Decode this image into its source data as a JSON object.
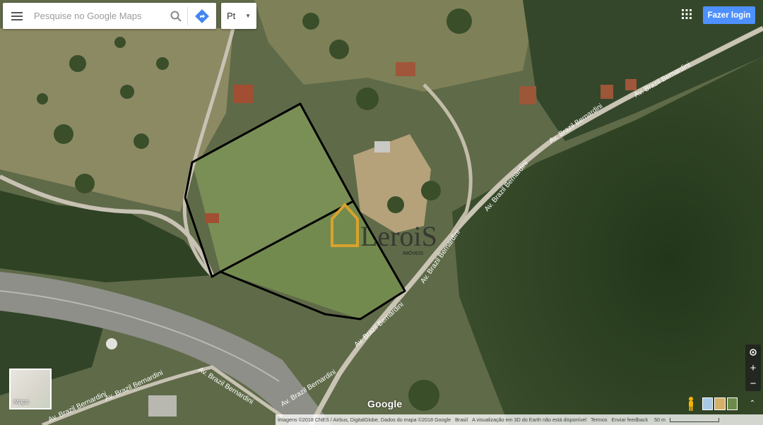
{
  "search": {
    "placeholder": "Pesquise no Google Maps"
  },
  "language": {
    "selected": "Pt"
  },
  "header": {
    "login_label": "Fazer login"
  },
  "thumbnail": {
    "label": "Maps"
  },
  "watermark": {
    "brand": "LeroiS",
    "subtitle": "IMÓVEIS"
  },
  "road_labels": {
    "top_right": "Av. Brazil Bernardini",
    "mid_right": "Av. Brazil Bernardini",
    "center": "Av. Brazil Bernardini",
    "lower_center": "Av. Brazil Bernardini",
    "lower_center_2": "Av. Brazil Bernardini",
    "bottom_left": "Av. Brazil Bernardini",
    "bottom_mid": "Av. Brazil Bernardini",
    "bottom_far_left": "Av. Brazil Bernardini",
    "bottom_left_edge": "Av. Brazil Bernardini"
  },
  "google_logo": "Google",
  "footer": {
    "imagery": "Imagens ©2018 CNES / Airbus, DigitalGlobe, Dados do mapa ©2018 Google",
    "country": "Brasil",
    "notice": "A visualização em 3D do Earth não está disponível",
    "terms": "Termos",
    "feedback": "Enviar feedback",
    "scale": "50 m"
  },
  "colors": {
    "accent": "#4d90fe",
    "boundary": "#000000",
    "watermark_gold": "#d9a22c"
  }
}
